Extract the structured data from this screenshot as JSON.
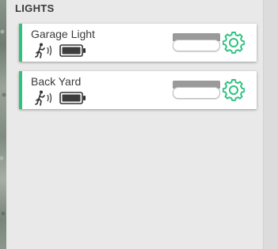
{
  "section": {
    "title": "LIGHTS"
  },
  "colors": {
    "accent": "#2ec27e",
    "gear": "#2ec27e",
    "toggle_off": "#9a9a9a"
  },
  "lights": [
    {
      "name": "Garage Light",
      "status_icons": [
        "motion-sensor-icon",
        "battery-icon"
      ],
      "toggle_state": "off",
      "settings_icon": "gear-icon"
    },
    {
      "name": "Back Yard",
      "status_icons": [
        "motion-sensor-icon",
        "battery-icon"
      ],
      "toggle_state": "off",
      "settings_icon": "gear-icon"
    }
  ]
}
